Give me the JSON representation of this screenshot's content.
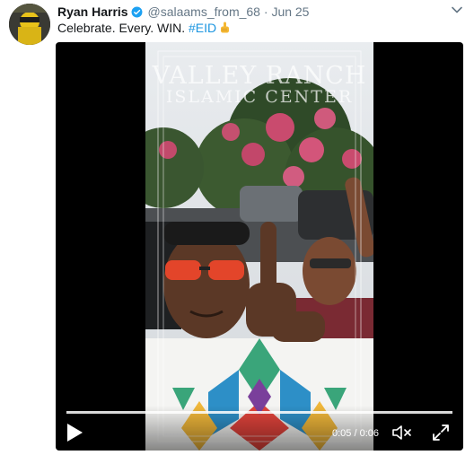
{
  "tweet": {
    "author_name": "Ryan Harris",
    "handle": "@salaams_from_68",
    "separator": "·",
    "date": "Jun 25",
    "text": "Celebrate. Every. WIN.",
    "hashtag": "#EID",
    "emoji": "pointing-up-hand"
  },
  "video": {
    "watermark_line1": "VALLEY RANCH",
    "watermark_line2": "ISLAMIC CENTER",
    "progress": 1.0,
    "time_display": "0:05 / 0:06",
    "icons": {
      "play": "play-icon",
      "mute": "mute-icon",
      "fullscreen": "fullscreen-icon"
    }
  },
  "colors": {
    "name": "#14171a",
    "meta": "#657786",
    "link": "#1b95e0",
    "verified": "#1da1f2"
  }
}
